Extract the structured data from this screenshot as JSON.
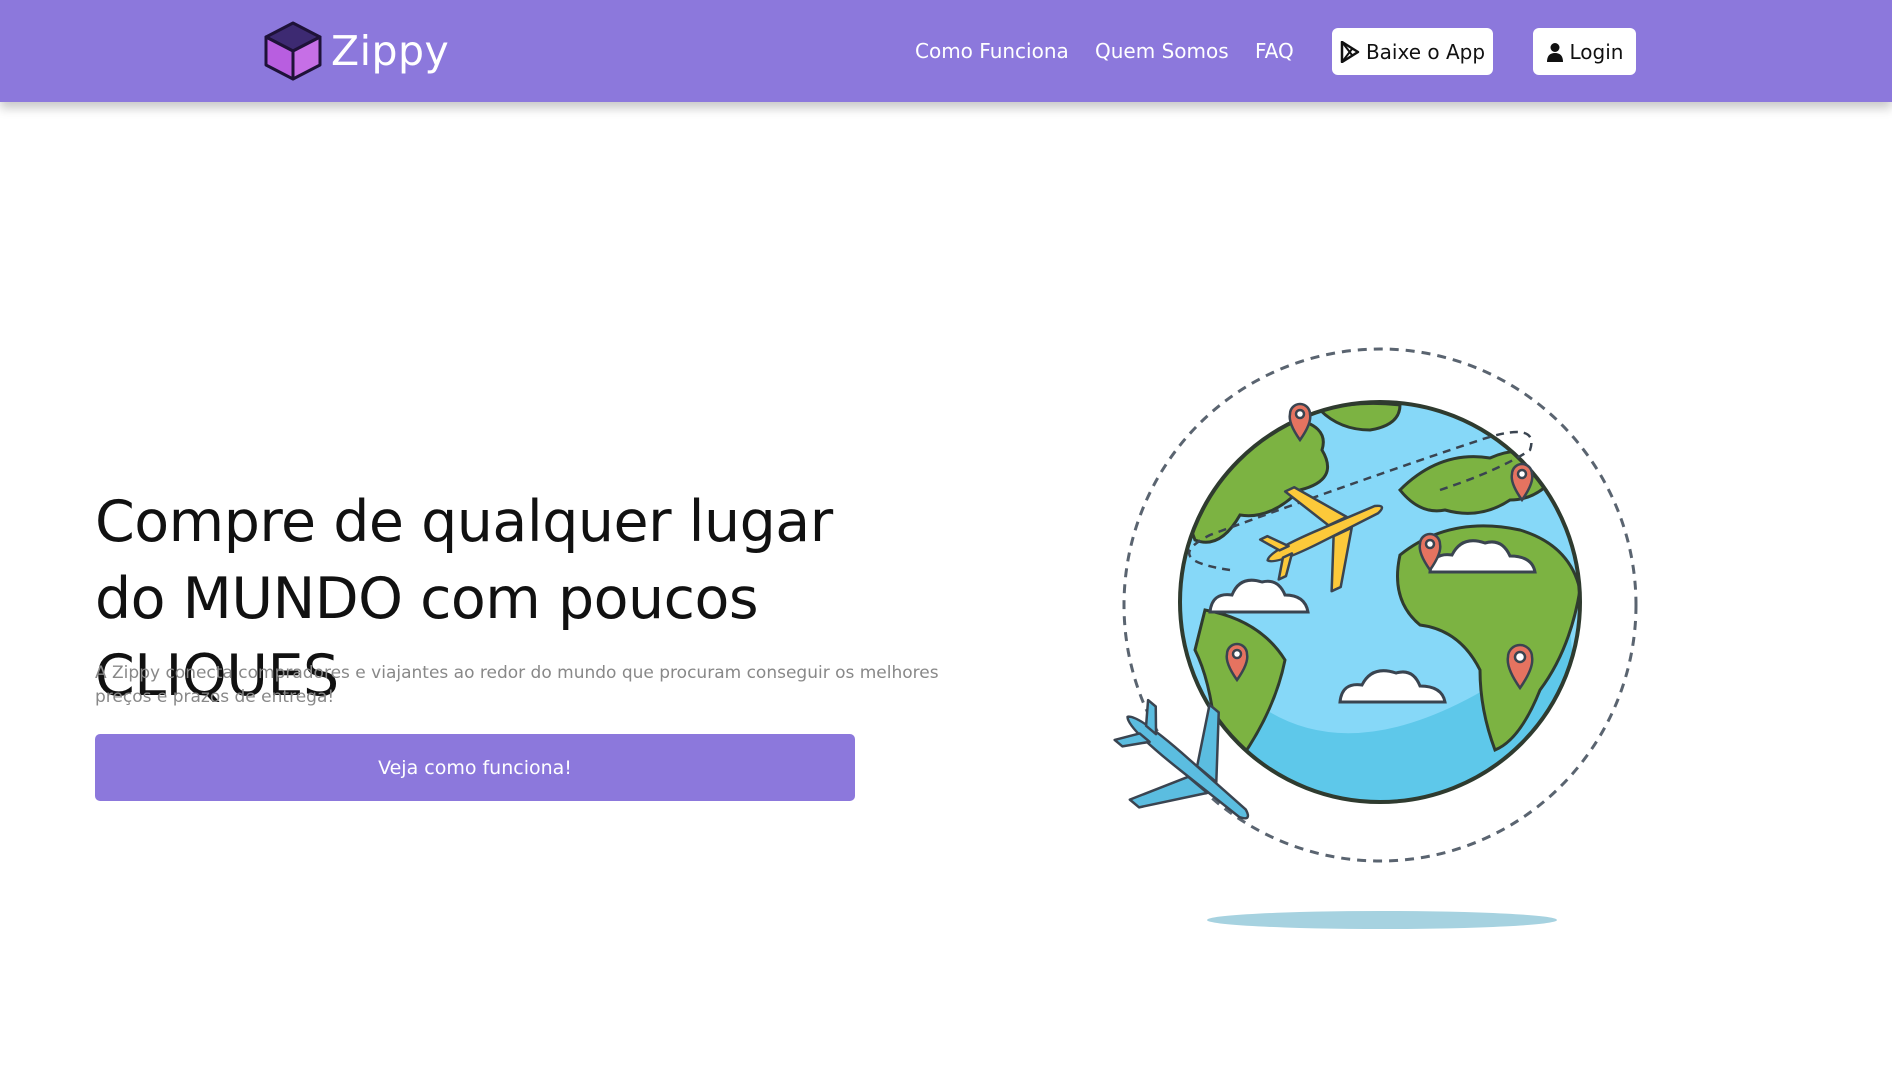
{
  "header": {
    "brand_name": "Zippy",
    "nav": {
      "how_it_works": "Como Funciona",
      "about": "Quem Somos",
      "faq": "FAQ"
    },
    "download_app": "Baixe o App",
    "login": "Login"
  },
  "hero": {
    "title_line1": "Compre de qualquer lugar",
    "title_line2": "do MUNDO com poucos CLIQUES",
    "description": "A Zippy conecta compradores e viajantes ao redor do mundo que procuram conseguir os melhores preços e prazos de entrega!",
    "cta_label": "Veja como funciona!"
  },
  "icons": {
    "logo": "cube-logo-icon",
    "download": "play-store-icon",
    "login": "user-icon",
    "illustration": "globe-planes-illustration"
  },
  "colors": {
    "primary": "#8c78dc",
    "text_dark": "#111111",
    "text_muted": "#888888"
  }
}
